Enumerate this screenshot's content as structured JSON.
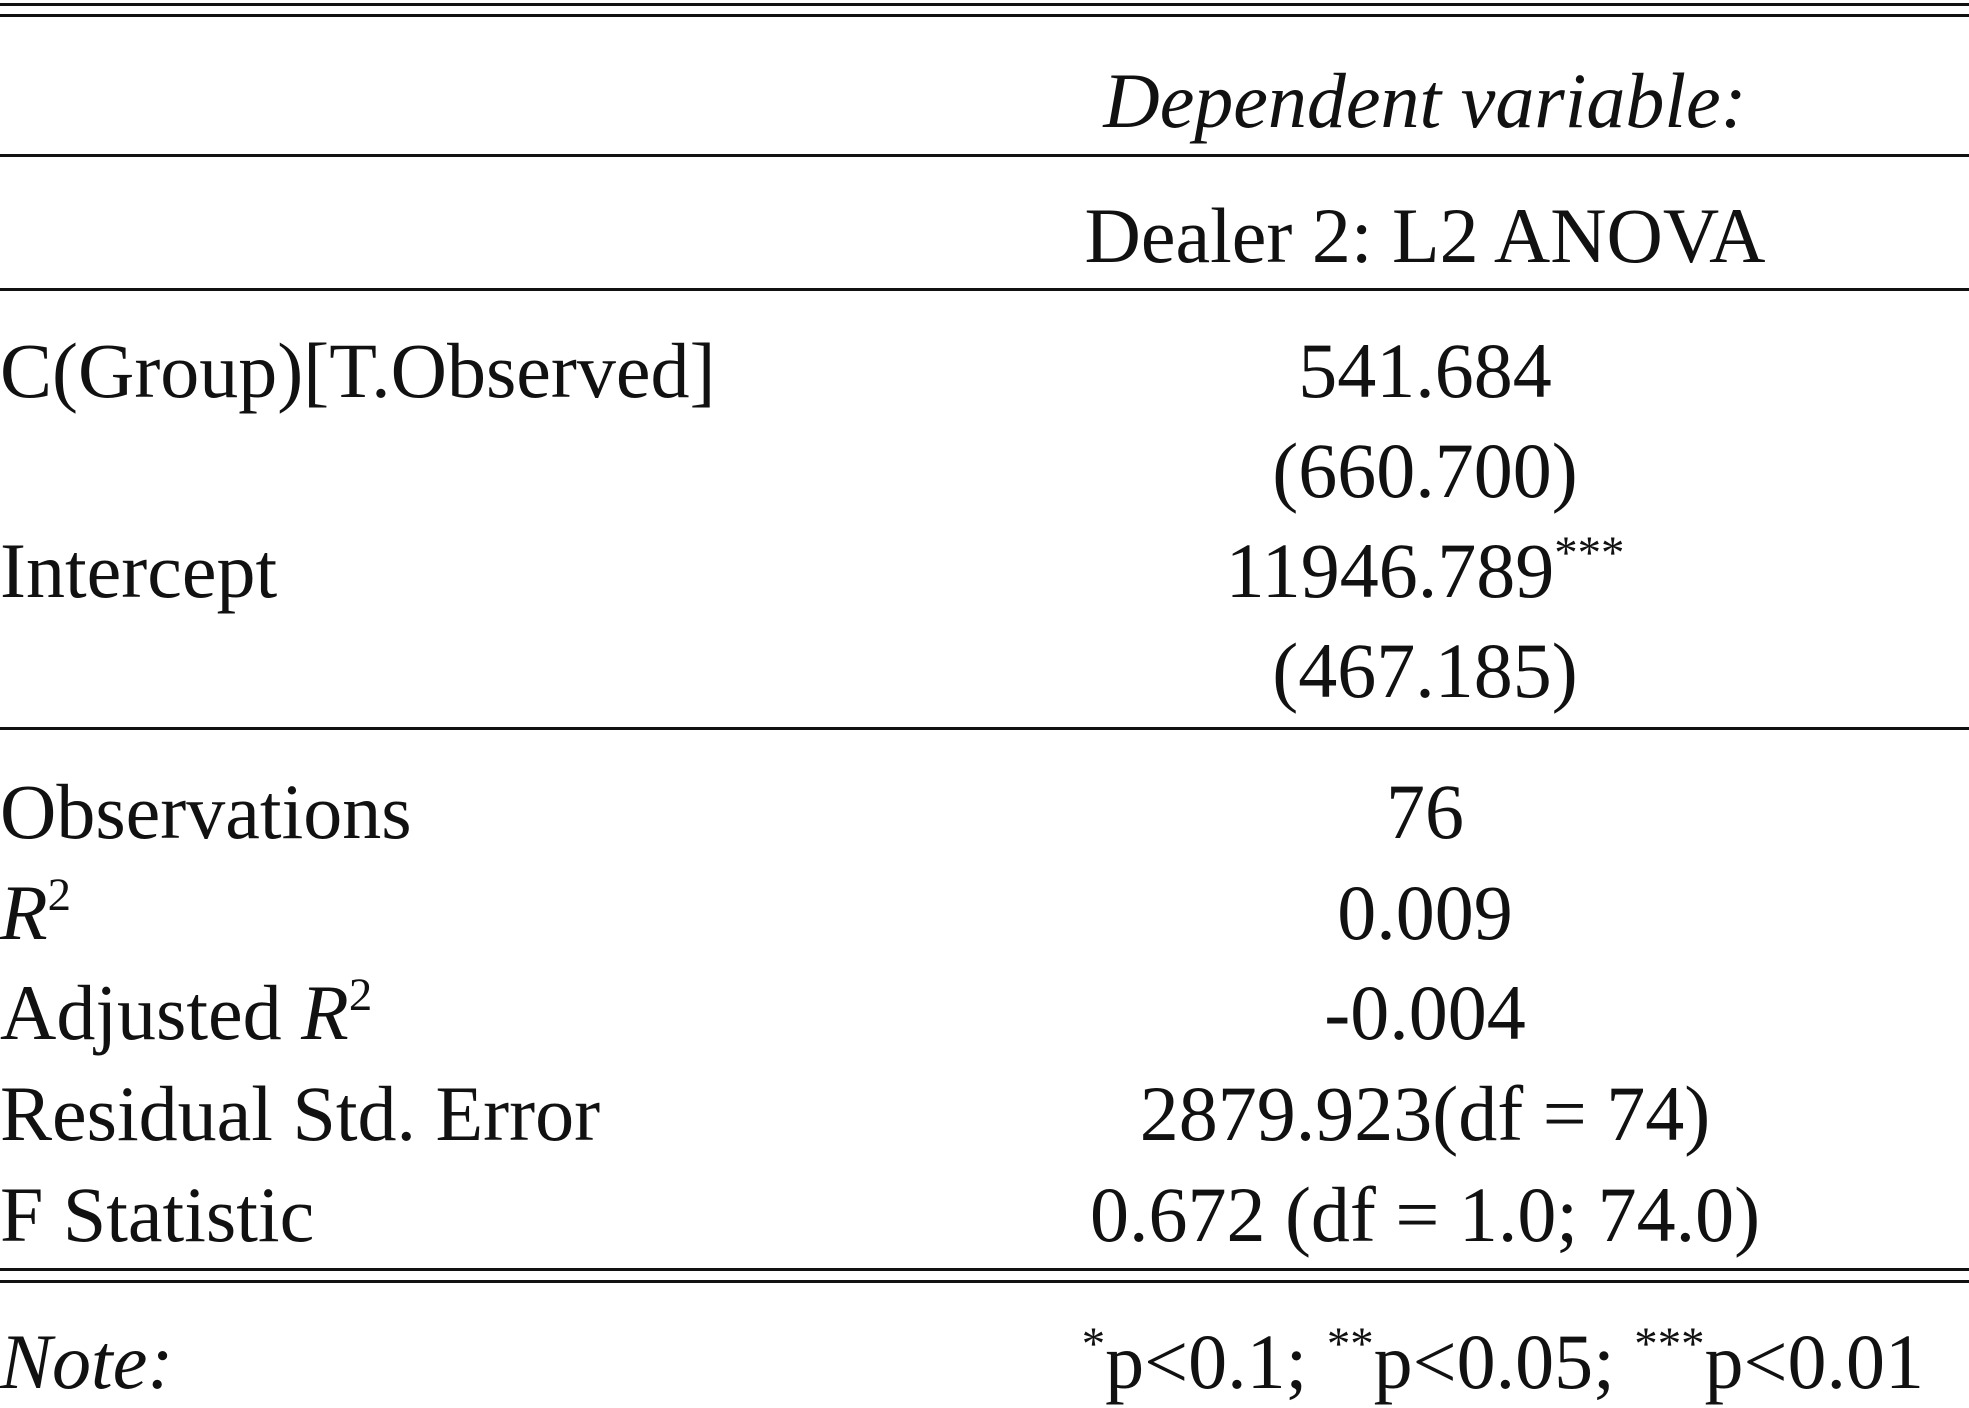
{
  "header": {
    "dependent_variable_label": "Dependent variable:",
    "model_name": "Dealer 2: L2 ANOVA"
  },
  "coefficients": [
    {
      "name": "C(Group)[T.Observed]",
      "estimate": "541.684",
      "stars": "",
      "std_error": "(660.700)"
    },
    {
      "name": "Intercept",
      "estimate": "11946.789",
      "stars": "***",
      "std_error": "(467.185)"
    }
  ],
  "stats": {
    "observations": {
      "label": "Observations",
      "value": "76"
    },
    "r2": {
      "label_symbol": "R",
      "label_exp": "2",
      "value": "0.009"
    },
    "adj_r2": {
      "label_prefix": "Adjusted ",
      "label_symbol": "R",
      "label_exp": "2",
      "value": "-0.004"
    },
    "resid_se": {
      "label": "Residual Std. Error",
      "value": "2879.923(df = 74)"
    },
    "f_stat": {
      "label": "F Statistic",
      "value": "0.672 (df = 1.0; 74.0)"
    }
  },
  "note": {
    "label": "Note:",
    "s1": "*",
    "t1": "p<0.1; ",
    "s2": "**",
    "t2": "p<0.05; ",
    "s3": "***",
    "t3": "p<0.01"
  }
}
